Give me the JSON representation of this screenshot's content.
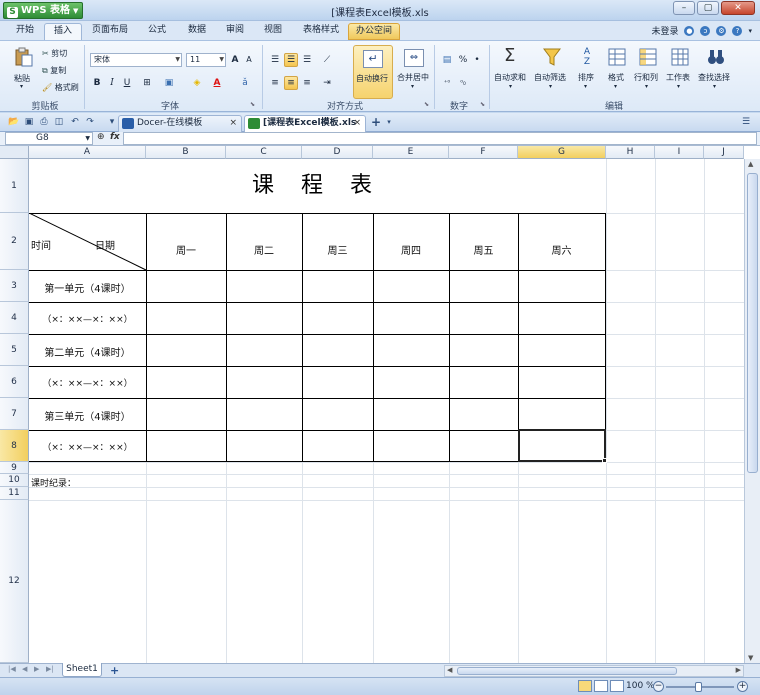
{
  "app": {
    "brand": "WPS 表格",
    "window_title": "[课程表Excel模板.xls",
    "login": "未登录"
  },
  "menu": {
    "tabs": [
      "开始",
      "插入",
      "页面布局",
      "公式",
      "数据",
      "审阅",
      "视图",
      "表格样式",
      "办公空间"
    ],
    "active": "插入"
  },
  "ribbon": {
    "clipboard": {
      "paste": "粘贴",
      "cut": "剪切",
      "copy": "复制",
      "format_painter": "格式刷",
      "label": "剪贴板"
    },
    "font": {
      "name": "宋体",
      "size": "11",
      "bold": "B",
      "italic": "I",
      "underline": "U",
      "label": "字体"
    },
    "align": {
      "wrap": "自动换行",
      "merge": "合并居中",
      "label": "对齐方式"
    },
    "number": {
      "percent": "%",
      "label": "数字"
    },
    "edit": {
      "autosum": "自动求和",
      "autofilter": "自动筛选",
      "sort": "排序",
      "format": "格式",
      "rows_cols": "行和列",
      "worksheet": "工作表",
      "find": "查找选择",
      "label": "编辑"
    }
  },
  "doc_tabs": [
    {
      "label": "Docer-在线模板"
    },
    {
      "label": "[课程表Excel模板.xls"
    }
  ],
  "formula_bar": {
    "cell_ref": "G8",
    "fx": "fx",
    "value": ""
  },
  "sheet": {
    "columns": [
      "A",
      "B",
      "C",
      "D",
      "E",
      "F",
      "G",
      "H",
      "I",
      "J"
    ],
    "selected_column": "G",
    "rows": [
      "1",
      "2",
      "3",
      "4",
      "5",
      "6",
      "7",
      "8",
      "9",
      "10",
      "11",
      "12"
    ],
    "selected_row": "8",
    "title": "课 程 表",
    "corner_time": "时间",
    "corner_date": "日期",
    "days": [
      "周一",
      "周二",
      "周三",
      "周四",
      "周五",
      "周六"
    ],
    "row_labels": [
      "第一单元（4课时）",
      "（×：××—×：××）",
      "第二单元（4课时）",
      "（×：××—×：××）",
      "第三单元（4课时）",
      "（×：××—×：××）"
    ],
    "note": "课时纪录："
  },
  "sheet_tabs": [
    "Sheet1"
  ],
  "status": {
    "zoom": "100 %"
  }
}
